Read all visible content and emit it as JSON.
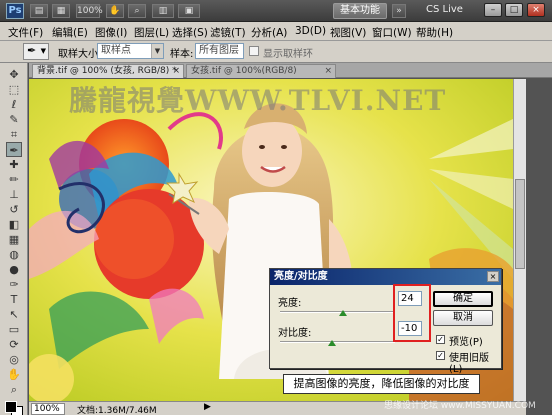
{
  "titlebar": {
    "logo": "Ps",
    "zoom_btn": "100%",
    "workspace_btn": "基本功能",
    "cs_live": "CS Live",
    "minimize": "–",
    "maximize": "□",
    "close": "×"
  },
  "menu": [
    "文件(F)",
    "编辑(E)",
    "图像(I)",
    "图层(L)",
    "选择(S)",
    "滤镜(T)",
    "分析(A)",
    "3D(D)",
    "视图(V)",
    "窗口(W)",
    "帮助(H)"
  ],
  "options": {
    "sample_size_label": "取样大小:",
    "sample_size_value": "取样点",
    "sample_label": "样本:",
    "sample_value": "所有图层",
    "show_ring_label": "显示取样环"
  },
  "tabs": [
    {
      "label": "背景.tif @ 100% (女孩, RGB/8) *",
      "close": "×"
    },
    {
      "label": "女孩.tif @ 100%(RGB/8)",
      "close": "×"
    }
  ],
  "canvas": {
    "watermark": "騰龍視覺WWW.TLVI.NET"
  },
  "status": {
    "zoom": "100%",
    "doc_info": "文档:1.36M/7.46M",
    "arrow": "▶"
  },
  "dialog": {
    "title": "亮度/对比度",
    "close": "×",
    "brightness_label": "亮度:",
    "brightness_value": "24",
    "brightness_level": 0.55,
    "contrast_label": "对比度:",
    "contrast_value": "-10",
    "contrast_level": 0.45,
    "ok_label": "确定",
    "cancel_label": "取消",
    "preview_label": "预览(P)",
    "preview_checked": "✓",
    "legacy_label": "使用旧版(L)",
    "legacy_checked": "✓"
  },
  "callout": "提高图像的亮度，降低图像的对比度",
  "site_watermark": "思缘设计论坛 www.MISSYUAN.COM",
  "colors": {
    "accent_red": "#e02020",
    "dialog_title": "#0a246a"
  },
  "tools": [
    "move-icon",
    "marquee-icon",
    "lasso-icon",
    "quick-select-icon",
    "crop-icon",
    "eyedropper-icon",
    "healing-icon",
    "brush-icon",
    "stamp-icon",
    "history-brush-icon",
    "eraser-icon",
    "gradient-icon",
    "blur-icon",
    "dodge-icon",
    "pen-icon",
    "type-icon",
    "path-select-icon",
    "shape-icon",
    "3d-rotate-icon",
    "3d-orbit-icon",
    "hand-icon",
    "zoom-icon"
  ],
  "tool_glyphs": [
    "✥",
    "⬚",
    "ℓ",
    "✎",
    "⌗",
    "✒",
    "✚",
    "✏",
    "⊥",
    "↺",
    "◧",
    "▦",
    "◍",
    "●",
    "✑",
    "T",
    "↖",
    "▭",
    "⟳",
    "◎",
    "✋",
    "⌕"
  ]
}
